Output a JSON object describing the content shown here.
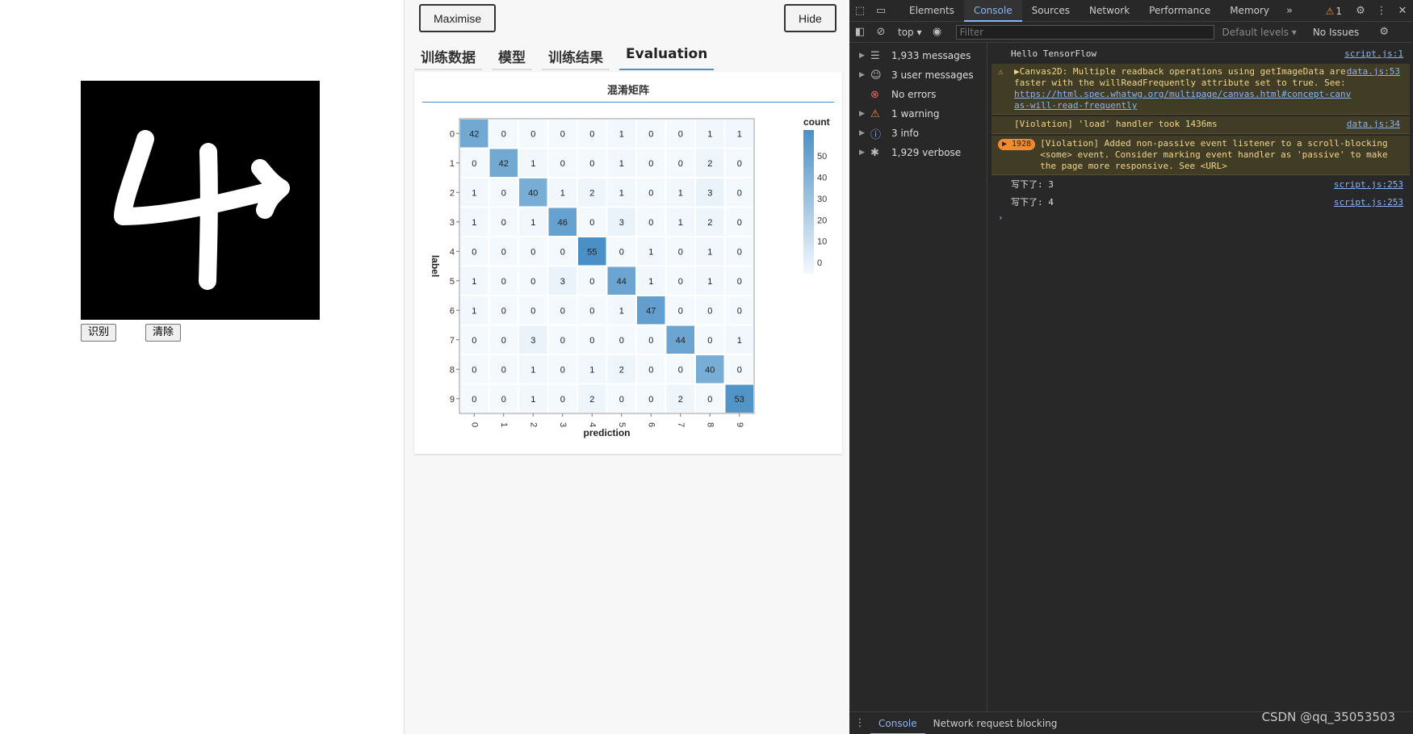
{
  "page": {
    "recognize_button": "识别",
    "clear_button": "清除",
    "drawn_digit": "4"
  },
  "visor": {
    "maximise_label": "Maximise",
    "hide_label": "Hide",
    "tabs": [
      {
        "label": "训练数据",
        "active": false
      },
      {
        "label": "模型",
        "active": false
      },
      {
        "label": "训练结果",
        "active": false
      },
      {
        "label": "Evaluation",
        "active": true
      }
    ],
    "surface_title": "混淆矩阵"
  },
  "chart_data": {
    "type": "heatmap",
    "title": "",
    "xlabel": "prediction",
    "ylabel": "label",
    "legend_title": "count",
    "legend_ticks": [
      0,
      10,
      20,
      30,
      40,
      50
    ],
    "x_categories": [
      "0",
      "1",
      "2",
      "3",
      "4",
      "5",
      "6",
      "7",
      "8",
      "9"
    ],
    "y_categories": [
      "0",
      "1",
      "2",
      "3",
      "4",
      "5",
      "6",
      "7",
      "8",
      "9"
    ],
    "values": [
      [
        42,
        0,
        0,
        0,
        0,
        1,
        0,
        0,
        1,
        1
      ],
      [
        0,
        42,
        1,
        0,
        0,
        1,
        0,
        0,
        2,
        0
      ],
      [
        1,
        0,
        40,
        1,
        2,
        1,
        0,
        1,
        3,
        0
      ],
      [
        1,
        0,
        1,
        46,
        0,
        3,
        0,
        1,
        2,
        0
      ],
      [
        0,
        0,
        0,
        0,
        55,
        0,
        1,
        0,
        1,
        0
      ],
      [
        1,
        0,
        0,
        3,
        0,
        44,
        1,
        0,
        1,
        0
      ],
      [
        1,
        0,
        0,
        0,
        0,
        1,
        47,
        0,
        0,
        0
      ],
      [
        0,
        0,
        3,
        0,
        0,
        0,
        0,
        44,
        0,
        1
      ],
      [
        0,
        0,
        1,
        0,
        1,
        2,
        0,
        0,
        40,
        0
      ],
      [
        0,
        0,
        1,
        0,
        2,
        0,
        0,
        2,
        0,
        53
      ]
    ],
    "color_low": "#f4f9fd",
    "color_high": "#4a90c6",
    "max_value": 55
  },
  "devtools": {
    "tabs": [
      {
        "label": "Elements",
        "active": false
      },
      {
        "label": "Console",
        "active": true
      },
      {
        "label": "Sources",
        "active": false
      },
      {
        "label": "Network",
        "active": false
      },
      {
        "label": "Performance",
        "active": false
      },
      {
        "label": "Memory",
        "active": false
      }
    ],
    "more_tabs": "»",
    "warning_count": "1",
    "context": "top",
    "filter_placeholder": "Filter",
    "default_levels": "Default levels ▾",
    "no_issues": "No Issues",
    "sidebar": [
      {
        "label": "1,933 messages",
        "icon": "list-icon"
      },
      {
        "label": "3 user messages",
        "icon": "user-icon"
      },
      {
        "label": "No errors",
        "icon": "error-icon"
      },
      {
        "label": "1 warning",
        "icon": "warning-icon"
      },
      {
        "label": "3 info",
        "icon": "info-icon"
      },
      {
        "label": "1,929 verbose",
        "icon": "bug-icon"
      }
    ],
    "messages": {
      "m1_text": "Hello TensorFlow",
      "m1_src": "script.js:1",
      "m2_text": "▶Canvas2D: Multiple readback operations using getImageData are faster with the willReadFrequently attribute set to true. See: ",
      "m2_link": "https://html.spec.whatwg.org/multipage/canvas.html#concept-canvas-will-read-frequently",
      "m2_src": "data.js:53",
      "m3_text": "[Violation] 'load' handler took 1436ms",
      "m3_src": "data.js:34",
      "m4_badge": "▶ 1928",
      "m4_text": "[Violation] Added non-passive event listener to a scroll-blocking <some> event. Consider marking event handler as 'passive' to make the page more responsive. See <URL>",
      "m5_text": "写下了: 3",
      "m5_src": "script.js:253",
      "m6_text": "写下了: 4",
      "m6_src": "script.js:253",
      "prompt": "›"
    },
    "drawer_tabs": [
      {
        "label": "Console",
        "active": true
      },
      {
        "label": "Network request blocking",
        "active": false
      }
    ]
  },
  "watermark": "CSDN @qq_35053503",
  "colors": {
    "accent": "#4a90c6",
    "devtools_bg": "#282828",
    "link": "#8ab4f8",
    "warning": "#f28b2c"
  }
}
